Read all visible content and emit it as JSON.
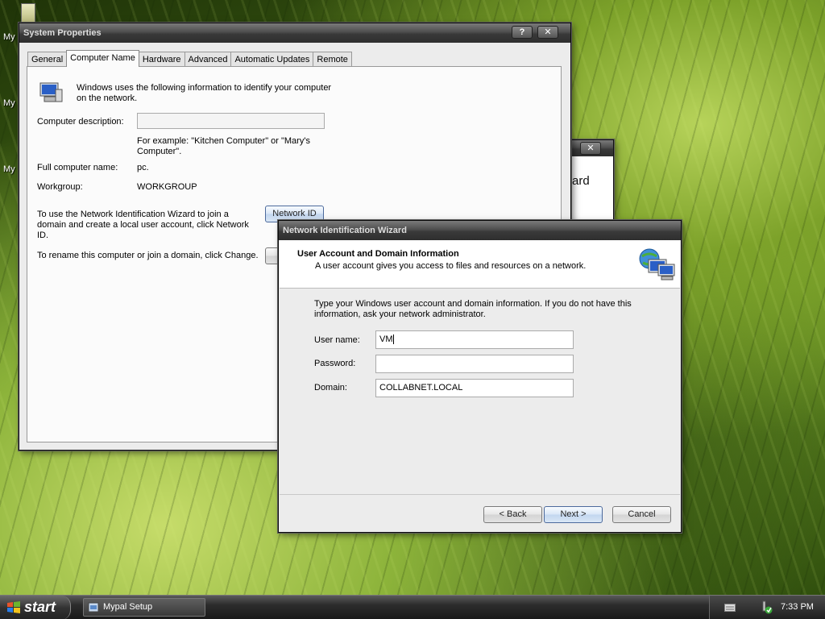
{
  "desktop": {
    "icon_labels": [
      "My",
      "My",
      "My"
    ]
  },
  "system_properties": {
    "title": "System Properties",
    "help_btn": "?",
    "close_btn": "✕",
    "tabs": [
      "General",
      "Computer Name",
      "Hardware",
      "Advanced",
      "Automatic Updates",
      "Remote"
    ],
    "active_tab": "Computer Name",
    "intro_line1": "Windows uses the following information to identify your computer",
    "intro_line2": "on the network.",
    "computer_description_label": "Computer description:",
    "computer_description_value": "",
    "example_line1": "For example: \"Kitchen Computer\" or \"Mary's",
    "example_line2": "Computer\".",
    "full_name_label": "Full computer name:",
    "full_name_value": "pc.",
    "workgroup_label": "Workgroup:",
    "workgroup_value": "WORKGROUP",
    "network_id_text1": "To use the Network Identification Wizard to join a",
    "network_id_text2": "domain and create a local user account, click Network",
    "network_id_text3": "ID.",
    "network_id_button": "Network ID",
    "rename_text": "To rename this computer or join a domain, click Change."
  },
  "background_dialog": {
    "close_btn": "✕",
    "partial_title": "ard"
  },
  "wizard": {
    "title": "Network Identification Wizard",
    "header_title": "User Account and Domain Information",
    "header_subtitle": "A user account gives you access to files and resources on a network.",
    "instructions_line1": "Type your Windows user account and domain information. If you do not have this",
    "instructions_line2": "information, ask your network administrator.",
    "username_label": "User name:",
    "username_value": "VM",
    "password_label": "Password:",
    "password_value": "",
    "domain_label": "Domain:",
    "domain_value": "COLLABNET.LOCAL",
    "back_button": "< Back",
    "next_button": "Next >",
    "cancel_button": "Cancel"
  },
  "taskbar": {
    "start_label": "start",
    "task_item": "Mypal Setup",
    "clock": "7:33 PM"
  }
}
